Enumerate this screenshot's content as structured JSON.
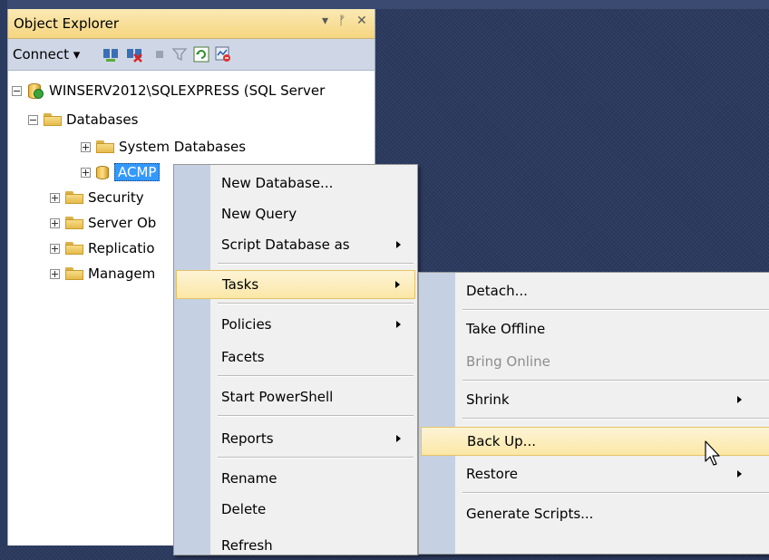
{
  "object_explorer": {
    "title": "Object Explorer",
    "pin_icon": "pin-icon",
    "close_icon": "close-icon",
    "dropdown_icon": "chevron-down-icon",
    "toolbar": {
      "connect_label": "Connect ▾",
      "icons": [
        "connect-icon",
        "disconnect-icon",
        "stop-icon",
        "filter-icon",
        "refresh-icon",
        "activity-monitor-icon"
      ]
    },
    "tree": {
      "server": "WINSERV2012\\SQLEXPRESS (SQL Server",
      "databases": "Databases",
      "system_databases": "System Databases",
      "selected_db": "ACMP",
      "security": "Security",
      "server_objects": "Server Ob",
      "replication": "Replicatio",
      "management": "Managem"
    }
  },
  "context_menu": {
    "items": [
      {
        "label": "New Database...",
        "has_submenu": false
      },
      {
        "label": "New Query",
        "has_submenu": false
      },
      {
        "label": "Script Database as",
        "has_submenu": true
      },
      {
        "label": "Tasks",
        "has_submenu": true,
        "highlighted": true
      },
      {
        "label": "Policies",
        "has_submenu": true
      },
      {
        "label": "Facets",
        "has_submenu": false
      },
      {
        "label": "Start PowerShell",
        "has_submenu": false
      },
      {
        "label": "Reports",
        "has_submenu": true
      },
      {
        "label": "Rename",
        "has_submenu": false
      },
      {
        "label": "Delete",
        "has_submenu": false
      },
      {
        "label": "Refresh",
        "has_submenu": false
      }
    ]
  },
  "tasks_submenu": {
    "items": [
      {
        "label": "Detach...",
        "has_submenu": false
      },
      {
        "label": "Take Offline",
        "has_submenu": false
      },
      {
        "label": "Bring Online",
        "has_submenu": false,
        "disabled": true
      },
      {
        "label": "Shrink",
        "has_submenu": true
      },
      {
        "label": "Back Up...",
        "has_submenu": false,
        "highlighted": true
      },
      {
        "label": "Restore",
        "has_submenu": true
      },
      {
        "label": "Generate Scripts...",
        "has_submenu": false
      }
    ]
  },
  "colors": {
    "selection": "#3399ff",
    "menu_highlight": "#fbe7a6",
    "menu_gutter": "#c5d1e3",
    "title_bar": "#f5d680"
  }
}
